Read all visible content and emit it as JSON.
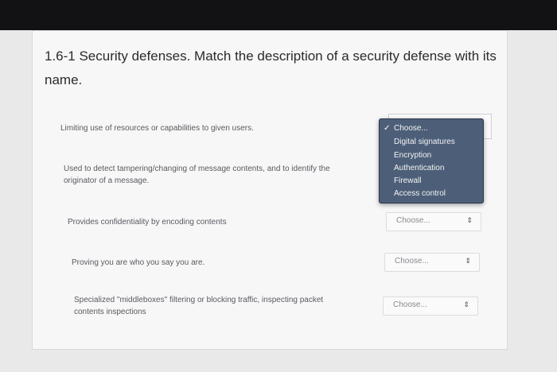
{
  "question": {
    "title": "1.6-1 Security defenses. Match the description of a security defense with its name."
  },
  "items": [
    {
      "description": "Limiting use of resources or capabilities to given users."
    },
    {
      "description": "Used to detect tampering/changing of message contents, and to identify the originator of a message."
    },
    {
      "description": "Provides confidentiality by encoding contents"
    },
    {
      "description": "Proving you are who you say you are."
    },
    {
      "description": "Specialized \"middleboxes\" filtering or blocking traffic, inspecting packet contents inspections"
    }
  ],
  "select": {
    "placeholder": "Choose...",
    "options": [
      "Choose...",
      "Digital signatures",
      "Encryption",
      "Authentication",
      "Firewall",
      "Access control"
    ]
  },
  "icons": {
    "check": "check-icon",
    "arrow": "updown-arrow-icon"
  }
}
